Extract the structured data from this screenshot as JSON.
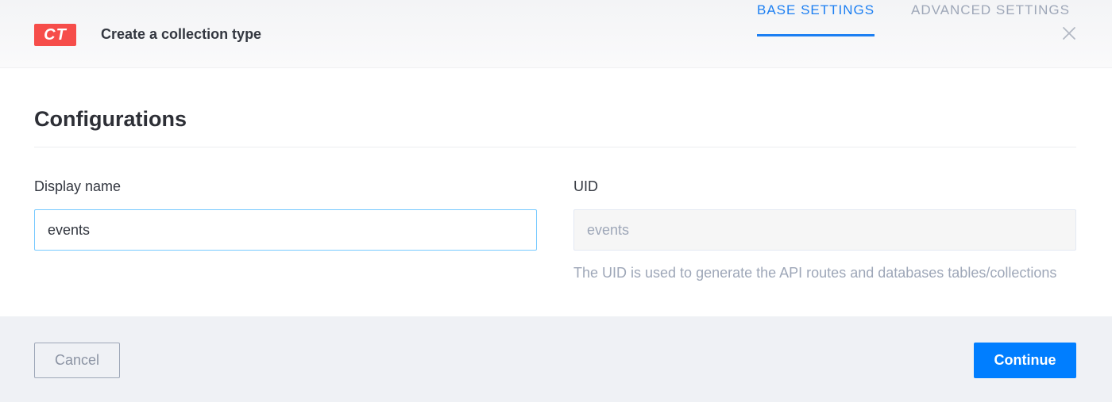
{
  "header": {
    "badge": "CT",
    "title": "Create a collection type",
    "close_icon": "close-icon"
  },
  "section": {
    "title": "Configurations"
  },
  "tabs": [
    {
      "label": "BASE SETTINGS",
      "active": true
    },
    {
      "label": "ADVANCED SETTINGS",
      "active": false
    }
  ],
  "form": {
    "display_name": {
      "label": "Display name",
      "value": "events"
    },
    "uid": {
      "label": "UID",
      "value": "events",
      "hint": "The UID is used to generate the API routes and databases tables/collections"
    }
  },
  "footer": {
    "cancel_label": "Cancel",
    "continue_label": "Continue"
  },
  "colors": {
    "badge": "#f64d4a",
    "accent": "#007eff",
    "tab_active": "#1c7ff2",
    "muted": "#9ea7b8"
  }
}
